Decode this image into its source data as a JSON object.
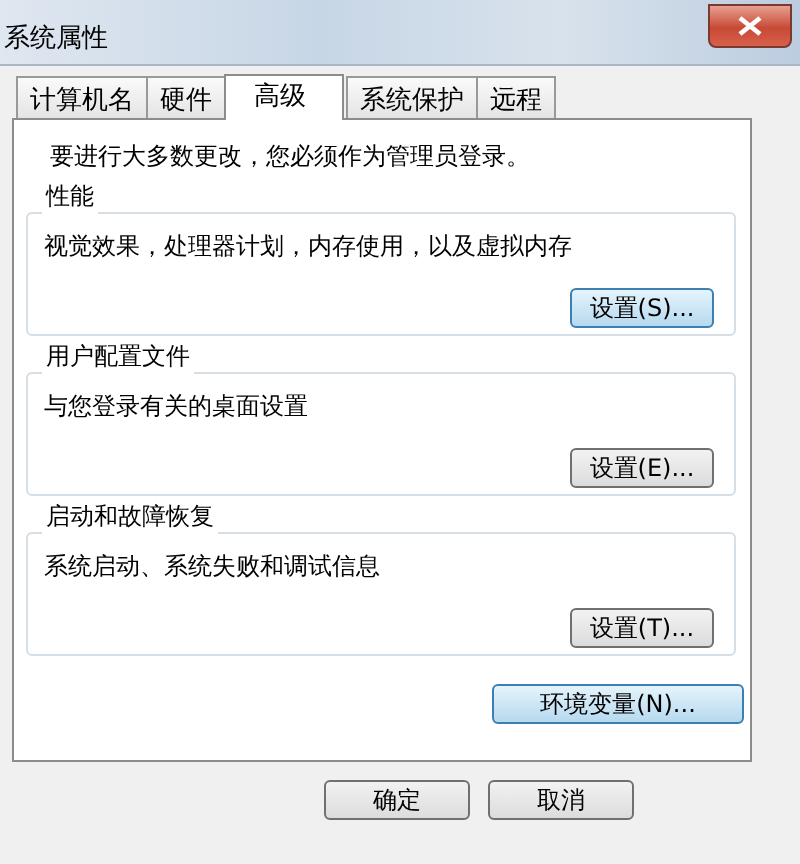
{
  "window": {
    "title": "系统属性"
  },
  "tabs": [
    {
      "label": "计算机名",
      "selected": false
    },
    {
      "label": "硬件",
      "selected": false
    },
    {
      "label": "高级",
      "selected": true
    },
    {
      "label": "系统保护",
      "selected": false
    },
    {
      "label": "远程",
      "selected": false
    }
  ],
  "notice": "要进行大多数更改，您必须作为管理员登录。",
  "groups": [
    {
      "title": "性能",
      "description": "视觉效果，处理器计划，内存使用，以及虚拟内存",
      "button": {
        "label": "设置(S)...",
        "focused": true
      }
    },
    {
      "title": "用户配置文件",
      "description": "与您登录有关的桌面设置",
      "button": {
        "label": "设置(E)...",
        "focused": false
      }
    },
    {
      "title": "启动和故障恢复",
      "description": "系统启动、系统失败和调试信息",
      "button": {
        "label": "设置(T)...",
        "focused": false
      }
    }
  ],
  "env_button": {
    "label": "环境变量(N)...",
    "focused": true
  },
  "dialog_buttons": [
    {
      "label": "确定"
    },
    {
      "label": "取消"
    }
  ]
}
